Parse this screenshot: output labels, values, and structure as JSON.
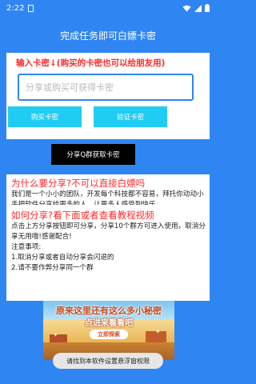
{
  "status_bar": {
    "time": "2:22",
    "icons": [
      "sd-card-icon",
      "wifi-icon",
      "signal-icon",
      "battery-icon"
    ]
  },
  "header": {
    "title": "完成任务即可白嫖卡密"
  },
  "code_card": {
    "heading": "输入卡密↓(购买的卡密也可以给朋友用)",
    "input_placeholder": "分享或购买可获得卡密",
    "input_value": "",
    "buy_label": "购买卡密",
    "verify_label": "验证卡密",
    "share_label": "分享Q群获取卡密"
  },
  "why_card": {
    "heading": "为什么要分享?不可以直接白嫖吗",
    "text": "我们是一个小小的团队，开发每个科技都不容易，拜托你动动小手把软件分享给更多的人，让更多人感受到快乐"
  },
  "how_card": {
    "heading": "如何分享?看下面或者查看教程视频",
    "line1": "点击上方分享按钮即可分享，分享10个群方可进入使用，取消分享无用哦!感谢配合!",
    "notice_title": "注意事项:",
    "notice_1": "1.取消分享或者自动分享会闪退的",
    "notice_2": "2.请不要作弊分享同一个群"
  },
  "banner": {
    "line1": "原来这里还有这么多小秘密",
    "line2": "点进来看看吧",
    "cta": "立即探索"
  },
  "toast": {
    "text": "请找到本软件设置悬浮窗权限"
  },
  "colors": {
    "background": "#2f86f2",
    "accent_red": "#ff2a2a",
    "button_cyan": "#20cdf2",
    "button_black": "#000000"
  }
}
